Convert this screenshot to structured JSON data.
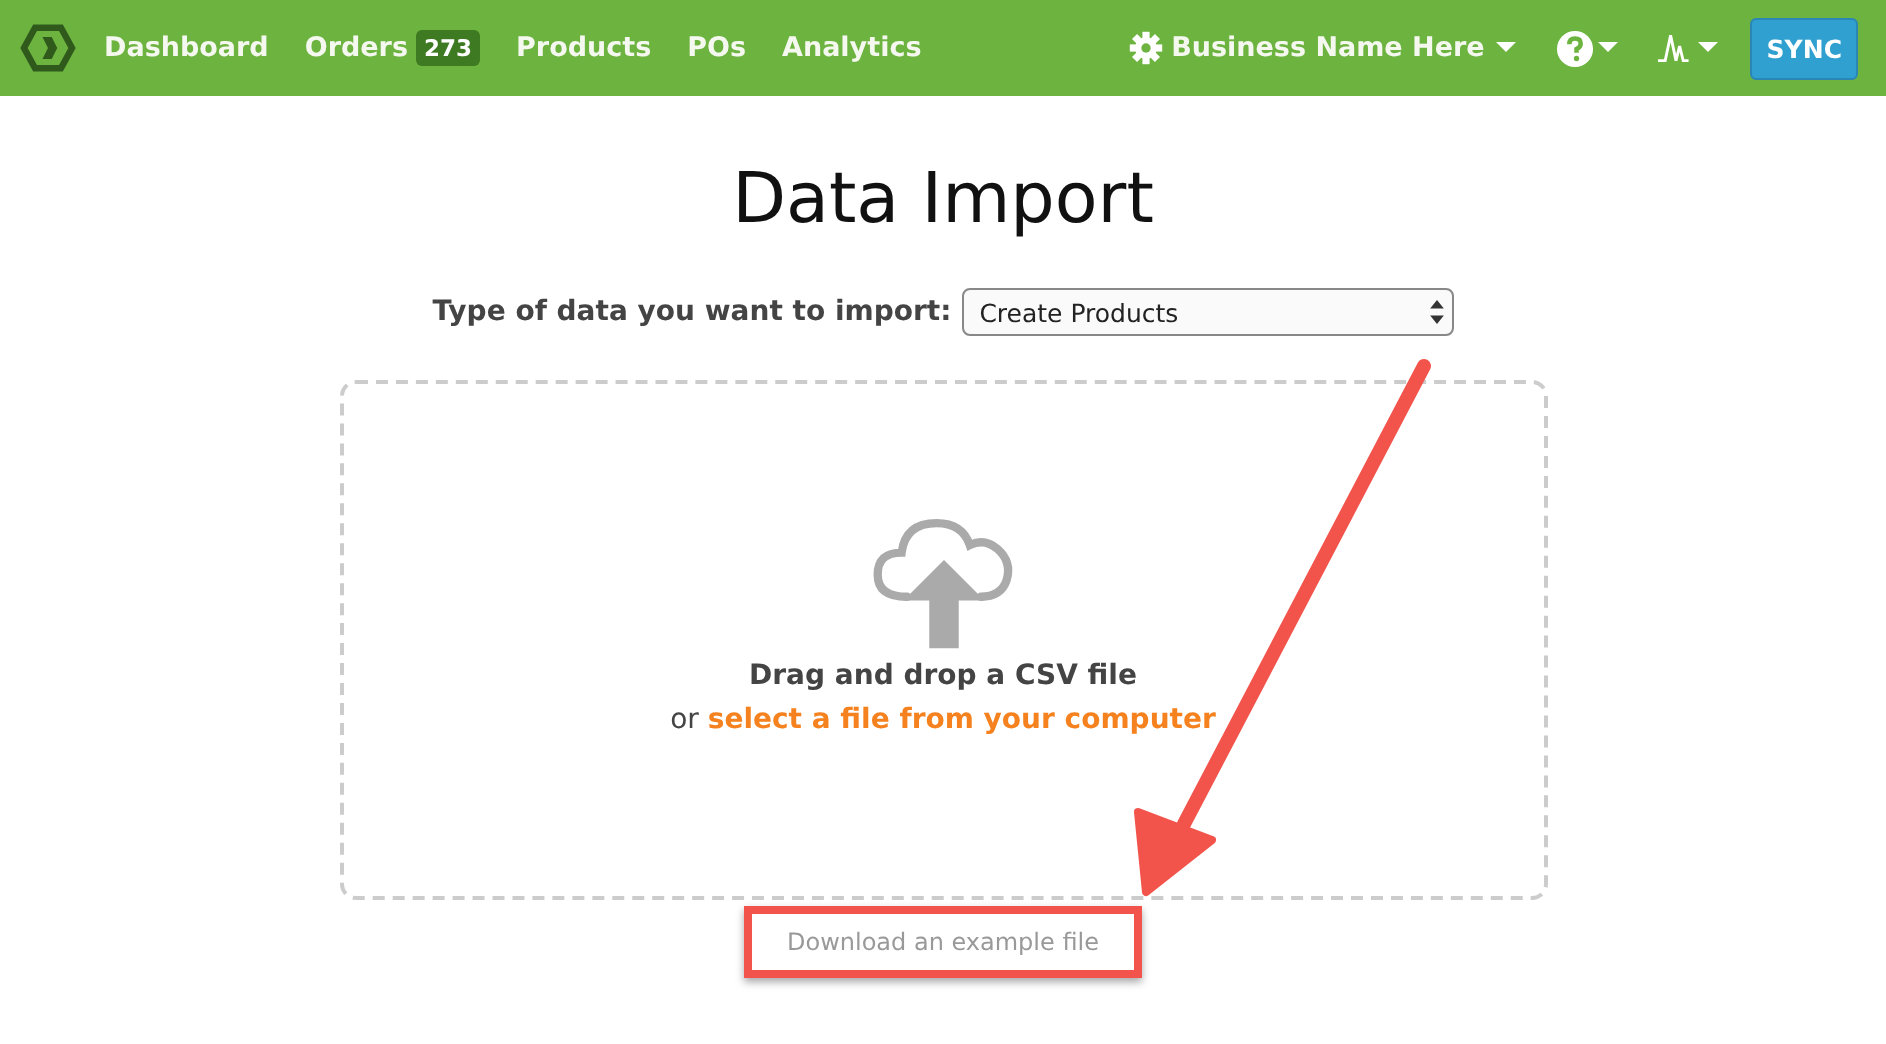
{
  "navbar": {
    "nav_items": [
      {
        "label": "Dashboard"
      },
      {
        "label": "Orders",
        "badge": "273"
      },
      {
        "label": "Products"
      },
      {
        "label": "POs"
      },
      {
        "label": "Analytics"
      }
    ],
    "business_menu": {
      "label": "Business Name Here"
    },
    "sync_button": {
      "label": "SYNC"
    }
  },
  "page": {
    "title": "Data Import",
    "type_label": "Type of data you want to import:",
    "type_select": {
      "value": "Create Products"
    },
    "dropzone": {
      "heading": "Drag and drop a CSV file",
      "or_text": "or",
      "link": "select a file from your computer"
    },
    "download_link": "Download an example file",
    "annotation": {
      "highlighted": true,
      "arrow": true
    }
  }
}
